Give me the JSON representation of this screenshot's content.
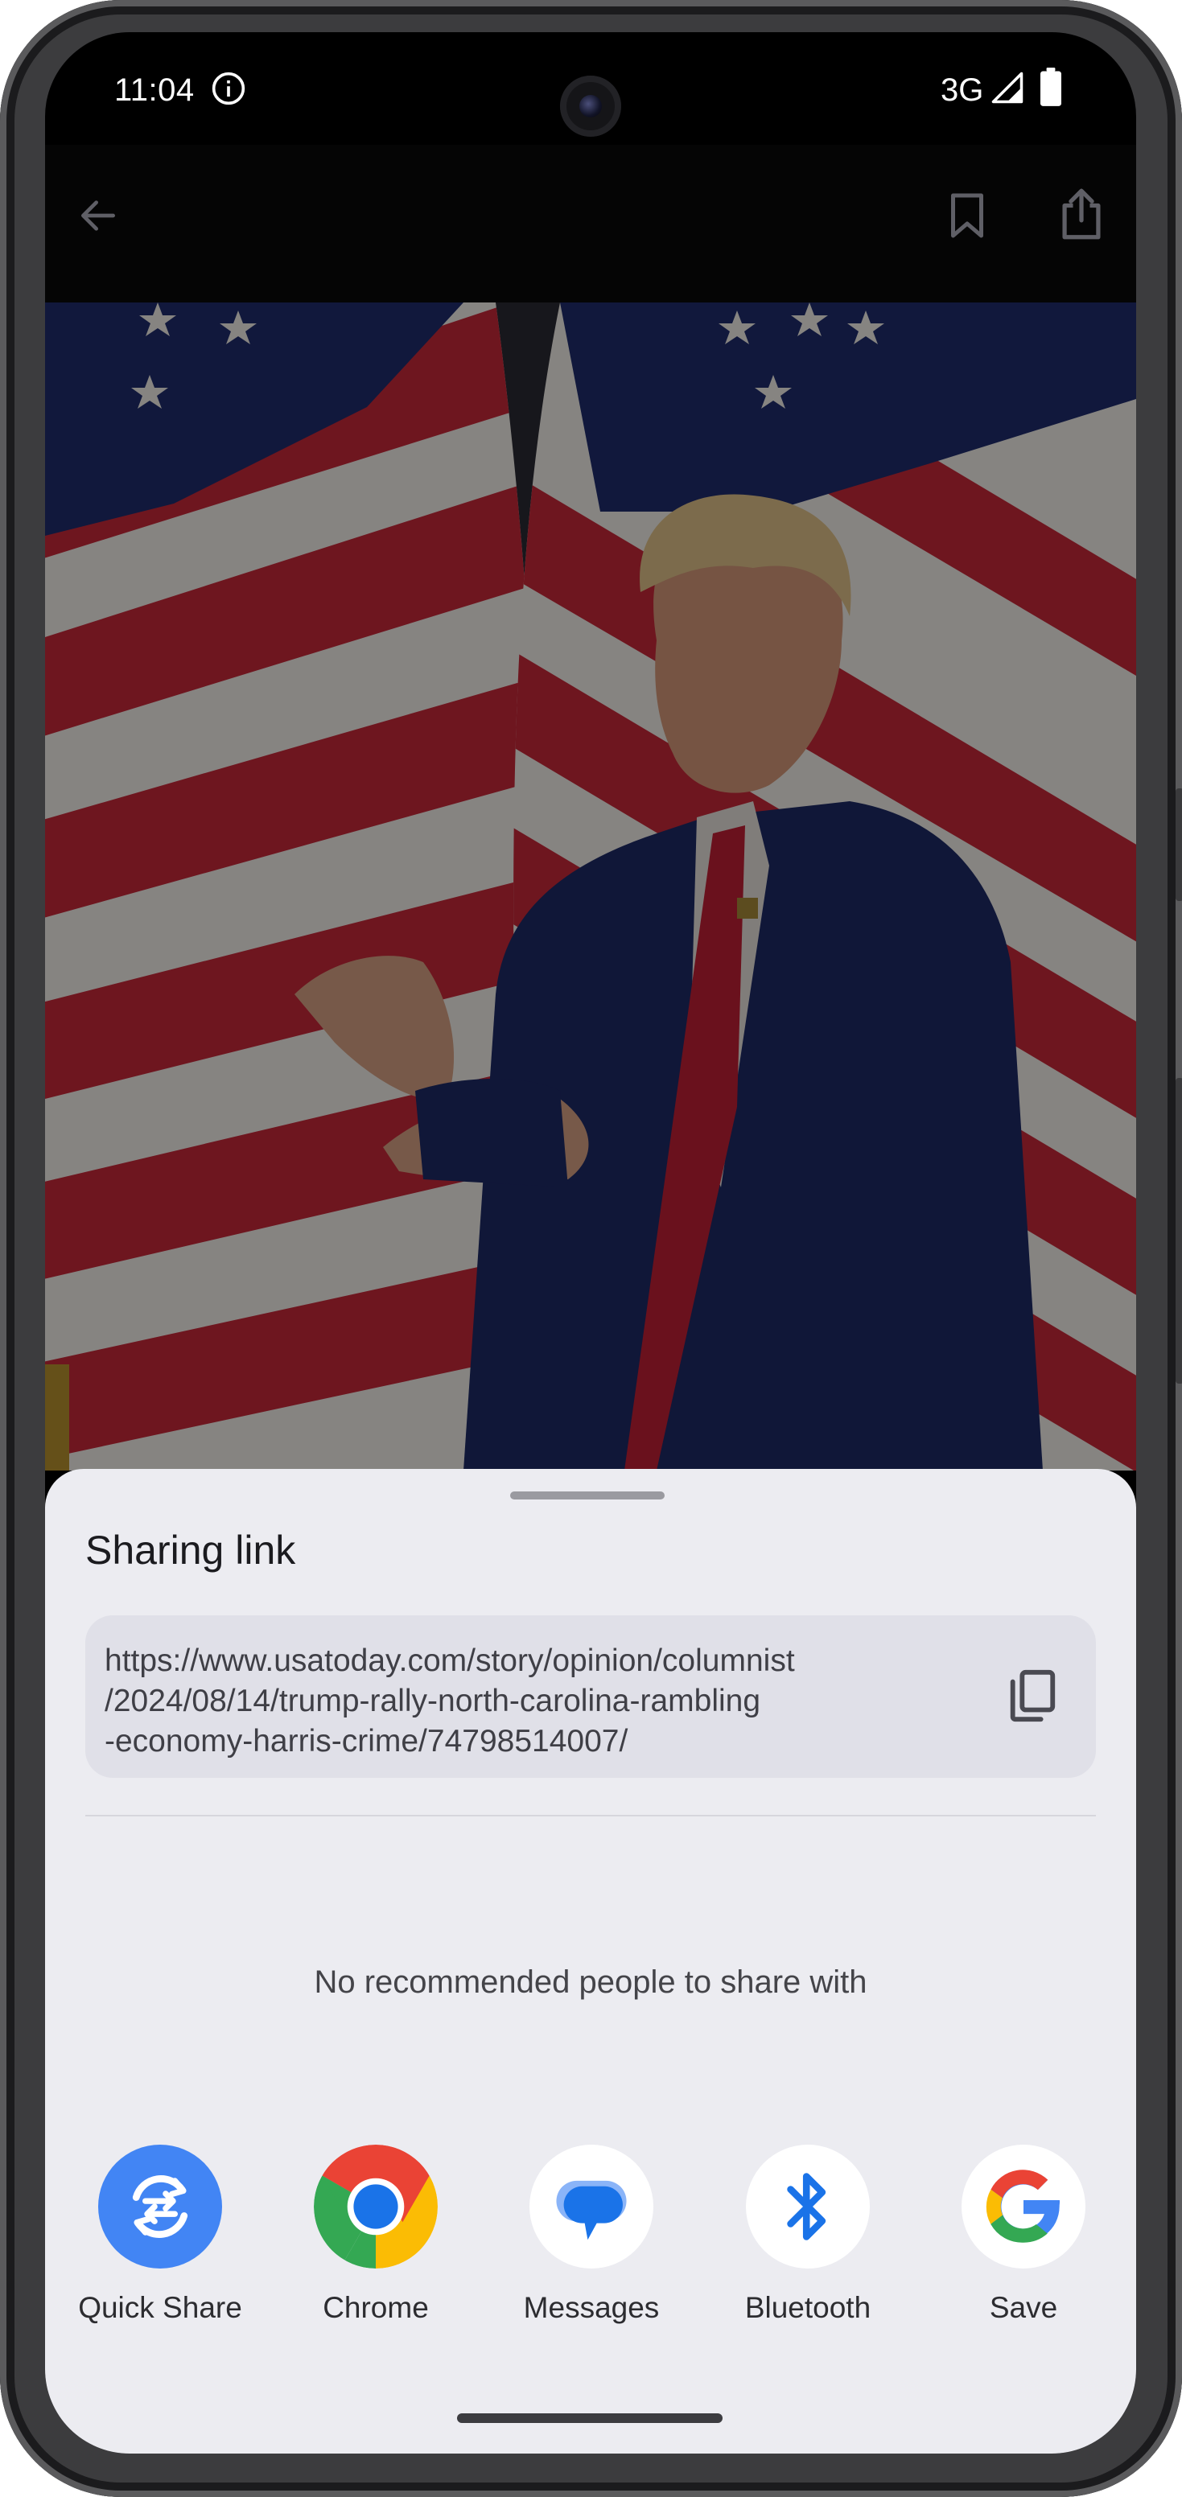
{
  "status_bar": {
    "time": "11:04",
    "network": "3G"
  },
  "app_bar": {
    "icons": [
      "back-arrow-icon",
      "bookmark-icon",
      "share-icon"
    ]
  },
  "article_image": {
    "subject": "flags-and-speaker-photo"
  },
  "share_sheet": {
    "title": "Sharing link",
    "url_lines": [
      "https://www.usatoday.com/story/opinion/columnist",
      "/2024/08/14/trump-rally-north-carolina-rambling",
      "-economy-harris-crime/74798514007/"
    ],
    "no_recommendations": "No recommended people to share with",
    "targets": [
      {
        "label": "Quick Share",
        "icon": "quick-share-icon"
      },
      {
        "label": "Chrome",
        "icon": "chrome-icon"
      },
      {
        "label": "Messages",
        "icon": "messages-icon"
      },
      {
        "label": "Bluetooth",
        "icon": "bluetooth-icon"
      },
      {
        "label": "Save",
        "icon": "google-icon"
      }
    ]
  },
  "colors": {
    "sheet_background": "#ececf1",
    "url_box": "#e0e0e8",
    "quick_share_blue": "#4285f4",
    "bluetooth_blue": "#1a73e8"
  }
}
